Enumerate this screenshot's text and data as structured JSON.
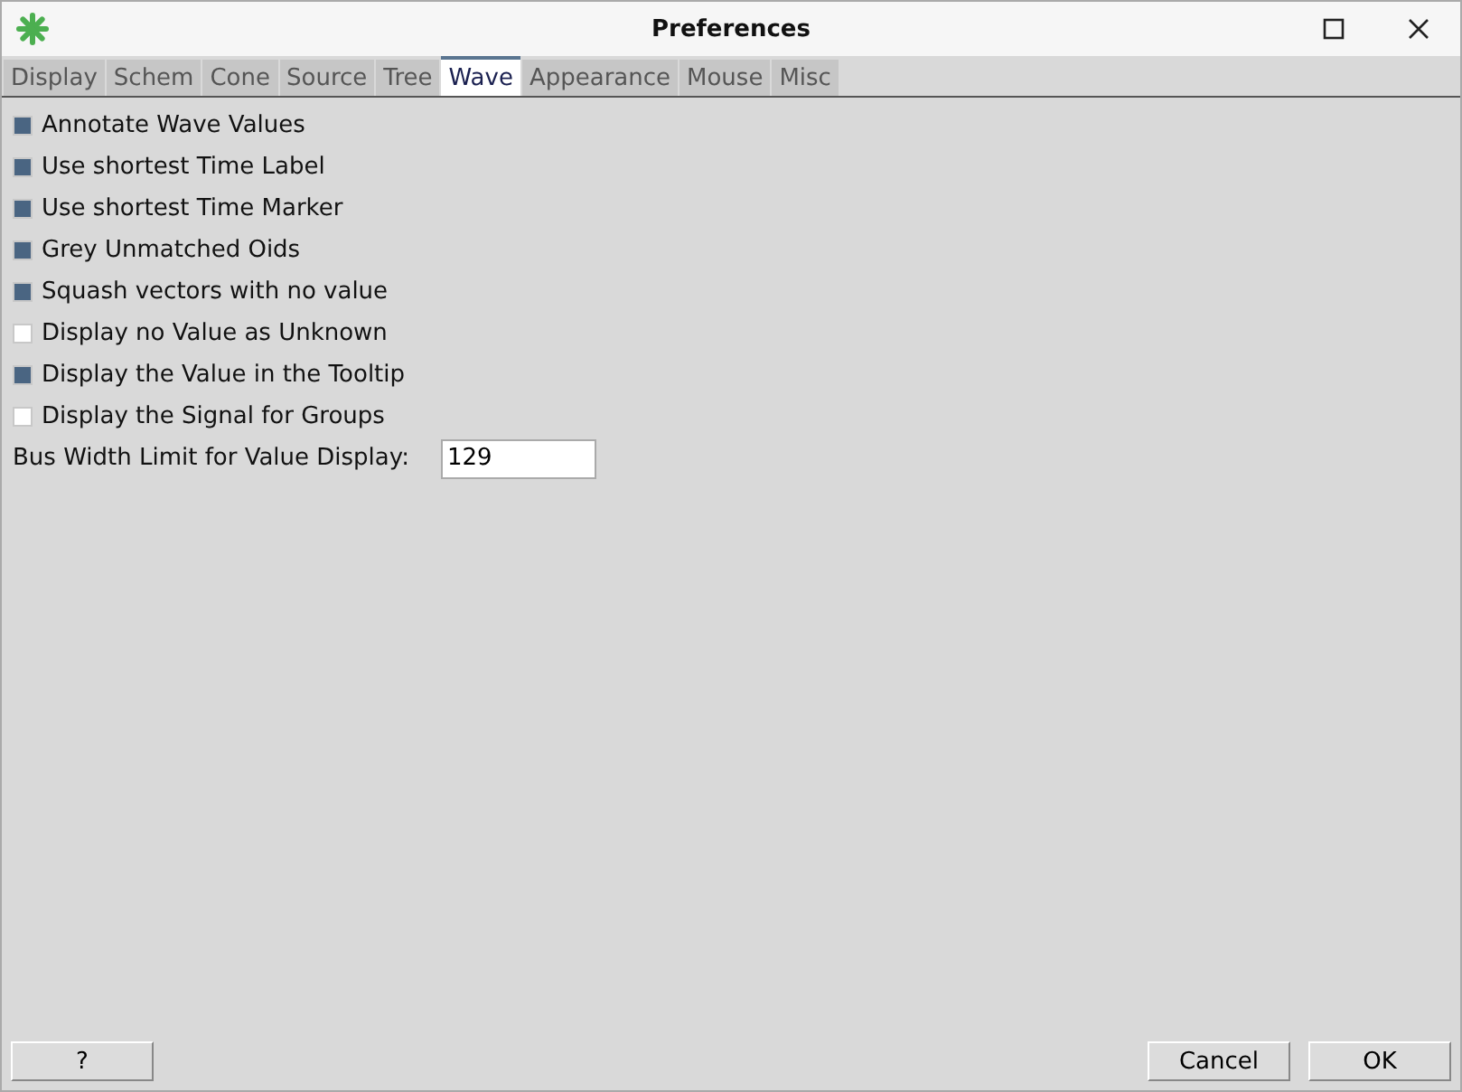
{
  "window": {
    "title": "Preferences"
  },
  "tabs": [
    {
      "label": "Display",
      "selected": false
    },
    {
      "label": "Schem",
      "selected": false
    },
    {
      "label": "Cone",
      "selected": false
    },
    {
      "label": "Source",
      "selected": false
    },
    {
      "label": "Tree",
      "selected": false
    },
    {
      "label": "Wave",
      "selected": true
    },
    {
      "label": "Appearance",
      "selected": false
    },
    {
      "label": "Mouse",
      "selected": false
    },
    {
      "label": "Misc",
      "selected": false
    }
  ],
  "options": [
    {
      "label": "Annotate Wave Values",
      "checked": true
    },
    {
      "label": "Use shortest Time Label",
      "checked": true
    },
    {
      "label": "Use shortest Time Marker",
      "checked": true
    },
    {
      "label": "Grey Unmatched Oids",
      "checked": true
    },
    {
      "label": "Squash vectors with no value",
      "checked": true
    },
    {
      "label": "Display no Value as Unknown",
      "checked": false
    },
    {
      "label": "Display the Value in the Tooltip",
      "checked": true
    },
    {
      "label": "Display the Signal for Groups",
      "checked": false
    }
  ],
  "bus_width": {
    "label": "Bus Width Limit for Value Display:",
    "value": "129"
  },
  "buttons": {
    "help": "?",
    "cancel": "Cancel",
    "ok": "OK"
  }
}
